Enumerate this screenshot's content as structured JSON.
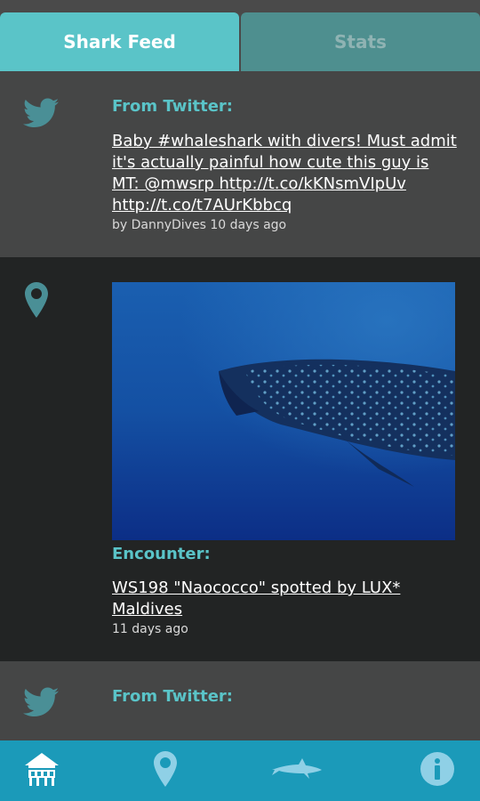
{
  "tabs": {
    "feed_label": "Shark Feed",
    "stats_label": "Stats"
  },
  "feed": [
    {
      "type": "twitter",
      "icon": "twitter-bird-icon",
      "title": "From Twitter:",
      "link": "Baby #whaleshark with divers! Must admit it's actually painful how cute this guy is MT: @mwsrp http://t.co/kKNsmVIpUv http://t.co/t7AUrKbbcq",
      "meta": "by DannyDives 10 days ago"
    },
    {
      "type": "encounter",
      "icon": "location-pin-icon",
      "image": "whale-shark-photo",
      "title": "Encounter:",
      "link": "WS198 \"Naococco\" spotted by LUX* Maldives",
      "meta": "11 days ago"
    },
    {
      "type": "twitter",
      "icon": "twitter-bird-icon",
      "title": "From Twitter:"
    }
  ],
  "colors": {
    "accent": "#5ac4c8",
    "tab_inactive": "#4e8f8f",
    "card_twitter_bg": "#454646",
    "card_encounter_bg": "#222424",
    "nav_bg": "#1b9ab9"
  },
  "nav": [
    "home-icon",
    "map-pin-icon",
    "shark-icon",
    "info-icon"
  ]
}
